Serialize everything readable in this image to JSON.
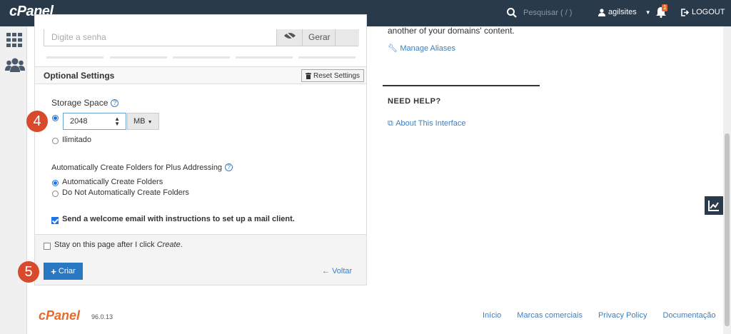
{
  "topbar": {
    "logo": "cPanel",
    "search_placeholder": "Pesquisar ( / )",
    "user": "agilsites",
    "notifications": "1",
    "logout": "LOGOUT"
  },
  "password": {
    "placeholder": "Digite a senha",
    "generate_label": "Gerar"
  },
  "optional": {
    "title": "Optional Settings",
    "reset_label": "Reset Settings",
    "storage_label": "Storage Space",
    "storage_value": "2048",
    "unit": "MB",
    "unlimited_label": "Ilimitado",
    "folders_label": "Automatically Create Folders for Plus Addressing",
    "auto_create": "Automatically Create Folders",
    "no_auto_create": "Do Not Automatically Create Folders",
    "welcome_email": "Send a welcome email with instructions to set up a mail client.",
    "stay_text": "Stay on this page after I click ",
    "stay_text_em": "Create",
    "stay_text_end": ".",
    "create_label": "Criar",
    "back_label": "Voltar"
  },
  "markers": {
    "step4": "4",
    "step5": "5"
  },
  "right": {
    "domains_text": "another of your domains' content.",
    "manage_aliases": "Manage Aliases",
    "need_help": "NEED HELP?",
    "about_interface": "About This Interface"
  },
  "footer": {
    "logo": "cPanel",
    "version": "96.0.13",
    "links": [
      "Início",
      "Marcas comerciais",
      "Privacy Policy",
      "Documentação"
    ]
  },
  "colors": {
    "topbar": "#293a4a",
    "accent": "#3d7fc1",
    "brand": "#e46a2d",
    "marker": "#d84a2b"
  }
}
